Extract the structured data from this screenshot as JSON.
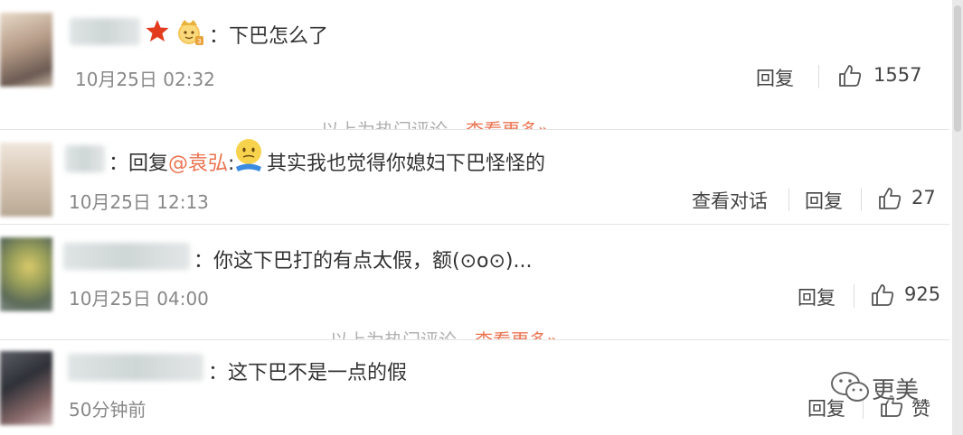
{
  "comments": [
    {
      "text": "：下巴怎么了",
      "time": "10月25日 02:32",
      "reply_label": "回复",
      "likes": "1557"
    },
    {
      "prefix": "：回复",
      "mention": "@袁弘",
      "colon": ":",
      "text": "其实我也觉得你媳妇下巴怪怪的",
      "time": "10月25日 12:13",
      "conversation_label": "查看对话",
      "reply_label": "回复",
      "likes": "27"
    },
    {
      "text": "：你这下巴打的有点太假，额(⊙o⊙)...",
      "time": "10月25日 04:00",
      "reply_label": "回复",
      "likes": "925"
    },
    {
      "text": "：这下巴不是一点的假",
      "time": "50分钟前",
      "reply_label": "回复",
      "likes": "赞"
    }
  ],
  "hot_divider": {
    "text": "以上为热门评论，",
    "more_label": "查看更多»"
  },
  "watermark": {
    "text": "更美"
  },
  "colors": {
    "accent": "#eb7350",
    "muted": "#888888"
  },
  "icons": [
    "star-icon",
    "crown-badge-icon",
    "emoji-icon",
    "thumbs-up-icon",
    "wechat-icon"
  ]
}
